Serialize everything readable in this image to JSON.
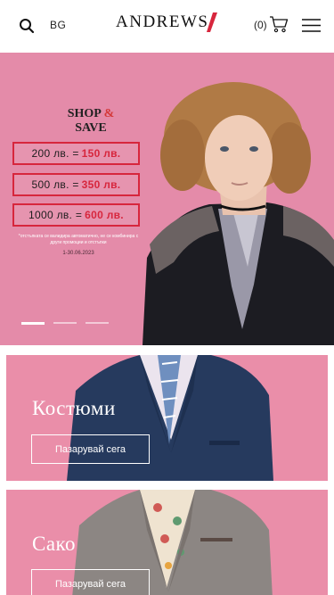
{
  "header": {
    "language": "BG",
    "logo": "ANDREWS",
    "cart_count": "(0)",
    "icons": [
      "search-icon",
      "cart-icon",
      "menu-icon"
    ]
  },
  "hero": {
    "promo_title_1": "SHOP",
    "promo_amp": "&",
    "promo_title_2": "SAVE",
    "offers": [
      {
        "old": "200 лв. =",
        "new": "150 лв."
      },
      {
        "old": "500 лв. =",
        "new": "350 лв."
      },
      {
        "old": "1000 лв. =",
        "new": "600 лв."
      }
    ],
    "note": "*отстъпката се валидира автоматично, не се комбинира с други промоции и отстъпки",
    "date": "1-30.06.2023",
    "slides": 3,
    "active_slide": 1
  },
  "categories": [
    {
      "title": "Костюми",
      "button": "Пазарувай сега"
    },
    {
      "title": "Сако",
      "button": "Пазарувай сега"
    }
  ],
  "colors": {
    "accent_red": "#d7263d",
    "hero_pink": "#e48ba9",
    "card_pink": "#ea8ea9"
  }
}
